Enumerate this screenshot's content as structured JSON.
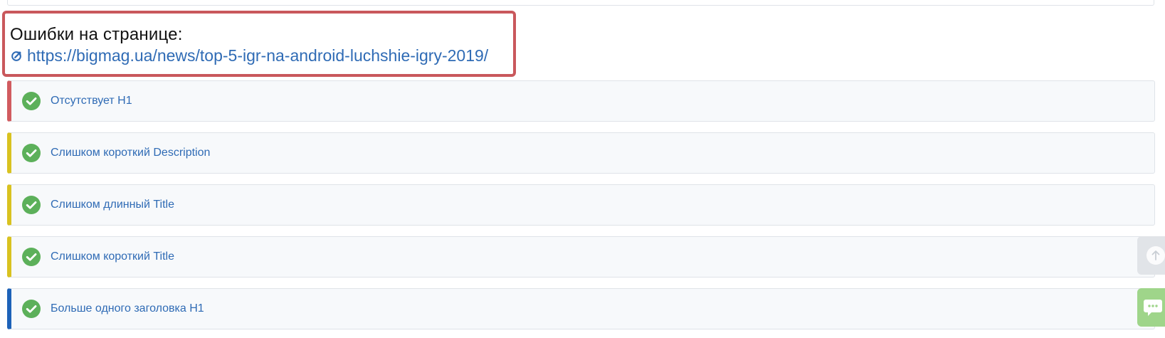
{
  "header": {
    "title": "Ошибки на странице:",
    "url": "https://bigmag.ua/news/top-5-igr-na-android-luchshie-igry-2019/"
  },
  "errors": [
    {
      "label": "Отсутствует H1",
      "status": "ok",
      "accent": "#d15b5f"
    },
    {
      "label": "Слишком короткий Description",
      "status": "ok",
      "accent": "#d9c21f"
    },
    {
      "label": "Слишком длинный Title",
      "status": "ok",
      "accent": "#d9c21f"
    },
    {
      "label": "Слишком короткий Title",
      "status": "ok",
      "accent": "#d9c21f"
    },
    {
      "label": "Больше одного заголовка H1",
      "status": "ok",
      "accent": "#1d62b8"
    }
  ],
  "colors": {
    "highlight_border": "#c9585c",
    "link": "#2f6bb5",
    "check": "#5cb05a",
    "chat_button": "#9fd58a",
    "scroll_button": "#e1e4e8"
  },
  "icons": {
    "link": "external-link-icon",
    "status": "check-circle-icon",
    "scroll": "arrow-up-icon",
    "chat": "chat-icon"
  }
}
